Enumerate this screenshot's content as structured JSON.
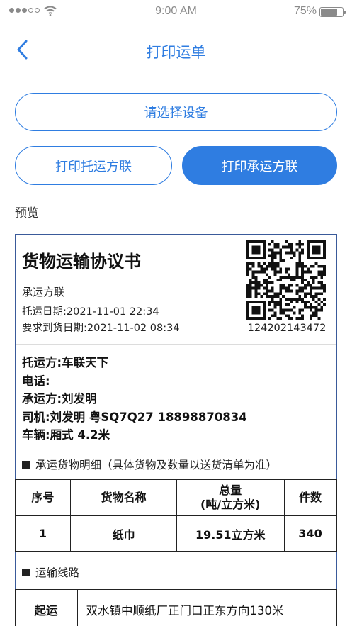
{
  "status_bar": {
    "time": "9:00 AM",
    "battery": "75%",
    "battery_level": 0.75
  },
  "nav": {
    "title": "打印运单",
    "back_icon": "chevron-left-icon"
  },
  "buttons": {
    "select_device": "请选择设备",
    "print_shipper_copy": "打印托运方联",
    "print_carrier_copy": "打印承运方联"
  },
  "preview_label": "预览",
  "document": {
    "title": "货物运输协议书",
    "copy_type": "承运方联",
    "consign_date": "托运日期:2021-11-01 22:34",
    "required_arrival": "要求到货日期:2021-11-02 08:34",
    "qr_number": "124202143472",
    "shipper": "托运方:车联天下",
    "phone": "电话:",
    "carrier": "承运方:刘发明",
    "driver": "司机:刘发明  粤SQ7Q27  18898870834",
    "vehicle": "车辆:厢式  4.2米",
    "goods_section": "承运货物明细（具体货物及数量以送货清单为准）",
    "goods_headers": {
      "index": "序号",
      "name": "货物名称",
      "total_line1": "总量",
      "total_line2": "(吨/立方米)",
      "count": "件数"
    },
    "goods_rows": [
      {
        "index": "1",
        "name": "纸巾",
        "total": "19.51立方米",
        "count": "340"
      }
    ],
    "route_section": "运输线路",
    "route_start_label": "起运",
    "route_start_value": "双水镇中顺纸厂正门口正东方向130米"
  },
  "colors": {
    "accent": "#2f7de1",
    "doc_border": "#3a5a9a"
  }
}
